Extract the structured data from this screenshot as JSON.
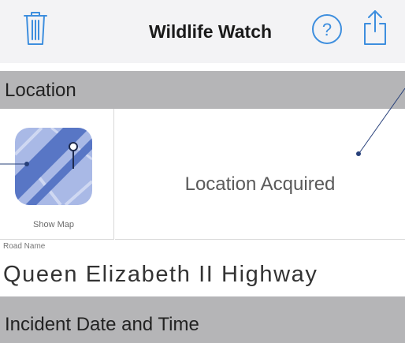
{
  "nav": {
    "title": "Wildlife Watch",
    "trash_icon": "trash-icon",
    "help_icon": "question-circle-icon",
    "share_icon": "share-icon",
    "accent_color": "#3d8ede"
  },
  "location_section": {
    "header": "Location",
    "show_map_label": "Show Map",
    "map_icon": "map-pin-icon",
    "status": "Location Acquired"
  },
  "road": {
    "label": "Road Name",
    "value": "Queen Elizabeth II Highway"
  },
  "incident_section": {
    "header": "Incident Date and Time"
  },
  "colors": {
    "nav_background": "#f3f3f5",
    "section_header": "#b5b5b7",
    "callout_line": "#27407a",
    "map_blue": "#5876c5"
  }
}
